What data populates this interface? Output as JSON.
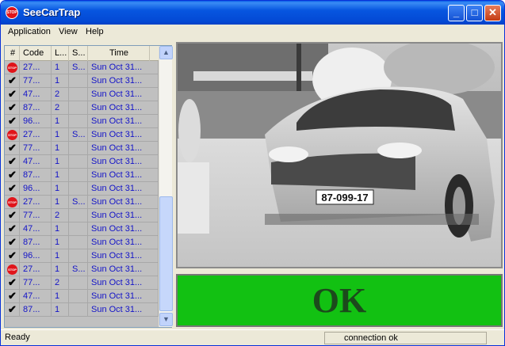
{
  "window": {
    "title": "SeeCarTrap"
  },
  "menu": [
    "Application",
    "View",
    "Help"
  ],
  "list": {
    "headers": [
      "#",
      "Code",
      "L...",
      "S...",
      "Time"
    ],
    "rows": [
      {
        "icon": "stop-icon",
        "code": "27...",
        "l": "1",
        "s": "S...",
        "time": "Sun Oct 31..."
      },
      {
        "icon": "check-icon",
        "code": "77...",
        "l": "1",
        "s": "",
        "time": "Sun Oct 31..."
      },
      {
        "icon": "check-icon",
        "code": "47...",
        "l": "2",
        "s": "",
        "time": "Sun Oct 31..."
      },
      {
        "icon": "check-icon",
        "code": "87...",
        "l": "2",
        "s": "",
        "time": "Sun Oct 31..."
      },
      {
        "icon": "check-icon",
        "code": "96...",
        "l": "1",
        "s": "",
        "time": "Sun Oct 31..."
      },
      {
        "icon": "stop-icon",
        "code": "27...",
        "l": "1",
        "s": "S...",
        "time": "Sun Oct 31..."
      },
      {
        "icon": "check-icon",
        "code": "77...",
        "l": "1",
        "s": "",
        "time": "Sun Oct 31..."
      },
      {
        "icon": "check-icon",
        "code": "47...",
        "l": "1",
        "s": "",
        "time": "Sun Oct 31..."
      },
      {
        "icon": "check-icon",
        "code": "87...",
        "l": "1",
        "s": "",
        "time": "Sun Oct 31..."
      },
      {
        "icon": "check-icon",
        "code": "96...",
        "l": "1",
        "s": "",
        "time": "Sun Oct 31..."
      },
      {
        "icon": "stop-icon",
        "code": "27...",
        "l": "1",
        "s": "S...",
        "time": "Sun Oct 31..."
      },
      {
        "icon": "check-icon",
        "code": "77...",
        "l": "2",
        "s": "",
        "time": "Sun Oct 31..."
      },
      {
        "icon": "check-icon",
        "code": "47...",
        "l": "1",
        "s": "",
        "time": "Sun Oct 31..."
      },
      {
        "icon": "check-icon",
        "code": "87...",
        "l": "1",
        "s": "",
        "time": "Sun Oct 31..."
      },
      {
        "icon": "check-icon",
        "code": "96...",
        "l": "1",
        "s": "",
        "time": "Sun Oct 31..."
      },
      {
        "icon": "stop-icon",
        "code": "27...",
        "l": "1",
        "s": "S...",
        "time": "Sun Oct 31..."
      },
      {
        "icon": "check-icon",
        "code": "77...",
        "l": "2",
        "s": "",
        "time": "Sun Oct 31..."
      },
      {
        "icon": "check-icon",
        "code": "47...",
        "l": "1",
        "s": "",
        "time": "Sun Oct 31..."
      },
      {
        "icon": "check-icon",
        "code": "87...",
        "l": "1",
        "s": "",
        "time": "Sun Oct 31..."
      }
    ]
  },
  "camera": {
    "plate": "87-099-17"
  },
  "result": {
    "text": "OK",
    "color": "#12c112"
  },
  "status": {
    "left": "Ready",
    "right": "connection ok"
  }
}
